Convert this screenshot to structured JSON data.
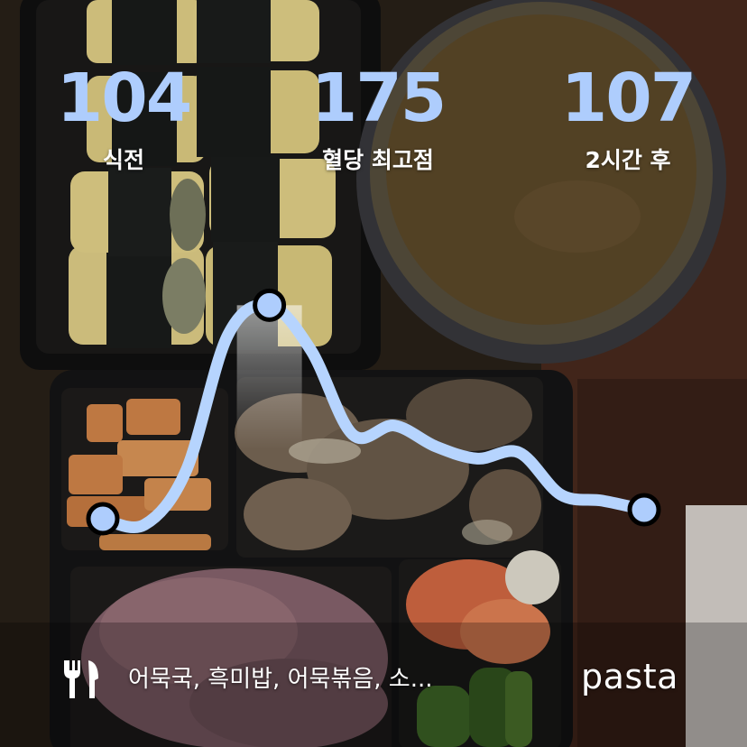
{
  "stats": [
    {
      "value": "104",
      "label": "식전"
    },
    {
      "value": "175",
      "label": "혈당 최고점"
    },
    {
      "value": "107",
      "label": "2시간 후"
    }
  ],
  "meal_text": "어묵국, 흑미밥, 어묵볶음, 소...",
  "brand": "pasta",
  "icons": {
    "meal": "fork-and-knife-icon"
  },
  "colors": {
    "curve": "#b6d4fe",
    "value_text": "#aecdfd",
    "marker_fill": "#aecdfd",
    "marker_stroke": "#000000"
  },
  "chart_data": {
    "type": "line",
    "title": "",
    "xlabel": "",
    "ylabel": "",
    "series": [
      {
        "values": [
          104,
          102,
          120,
          165,
          175,
          160,
          132,
          135,
          128,
          124,
          126,
          112,
          110,
          107
        ]
      }
    ],
    "markers": [
      {
        "index": 0,
        "value": 104
      },
      {
        "index": 4,
        "value": 175
      },
      {
        "index": 13,
        "value": 107
      }
    ],
    "ylim": [
      95,
      185
    ],
    "grid": false,
    "legend": "none"
  }
}
